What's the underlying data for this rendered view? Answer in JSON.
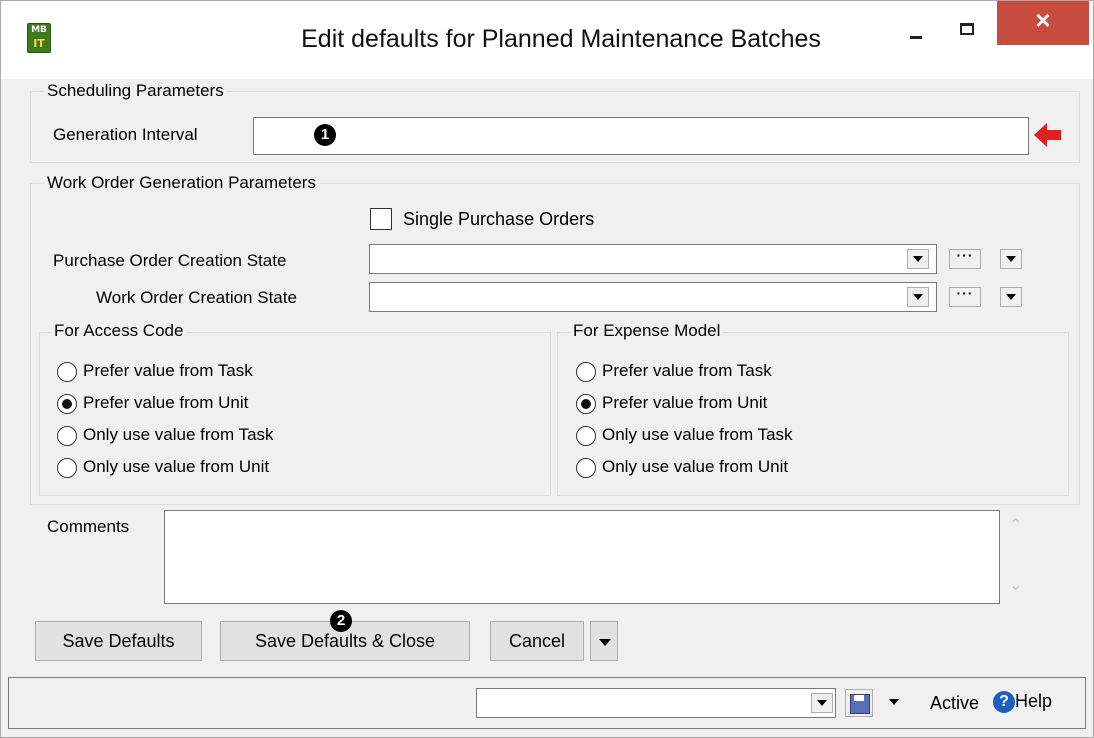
{
  "window": {
    "title": "Edit defaults for Planned Maintenance Batches",
    "icon_lines": [
      "MB",
      "IT"
    ],
    "close_label": "×"
  },
  "scheduling": {
    "legend": "Scheduling Parameters",
    "generation_interval_label": "Generation Interval",
    "generation_interval_value": "",
    "required_indicator": "red-arrow-left-icon"
  },
  "work_order": {
    "legend": "Work Order Generation Parameters",
    "single_po_label": "Single Purchase Orders",
    "single_po_checked": false,
    "po_state_label": "Purchase Order Creation State",
    "po_state_value": "",
    "wo_state_label": "Work Order Creation State",
    "wo_state_value": "",
    "ellipsis": "···"
  },
  "access_code": {
    "legend": "For Access Code",
    "options": [
      "Prefer value from Task",
      "Prefer value from Unit",
      "Only use value from Task",
      "Only use value from Unit"
    ],
    "selected_index": 1
  },
  "expense_model": {
    "legend": "For Expense Model",
    "options": [
      "Prefer value from Task",
      "Prefer value from Unit",
      "Only use value from Task",
      "Only use value from Unit"
    ],
    "selected_index": 1
  },
  "comments": {
    "label": "Comments",
    "value": ""
  },
  "buttons": {
    "save_defaults": "Save Defaults",
    "save_defaults_close": "Save Defaults & Close",
    "cancel": "Cancel"
  },
  "markers": {
    "one": "1",
    "two": "2"
  },
  "statusbar": {
    "dropdown_value": "",
    "status": "Active",
    "help": "Help",
    "help_glyph": "?"
  },
  "colors": {
    "close_button": "#c74b3f",
    "required_arrow": "#e0201a",
    "help_icon": "#1f5fbf"
  }
}
